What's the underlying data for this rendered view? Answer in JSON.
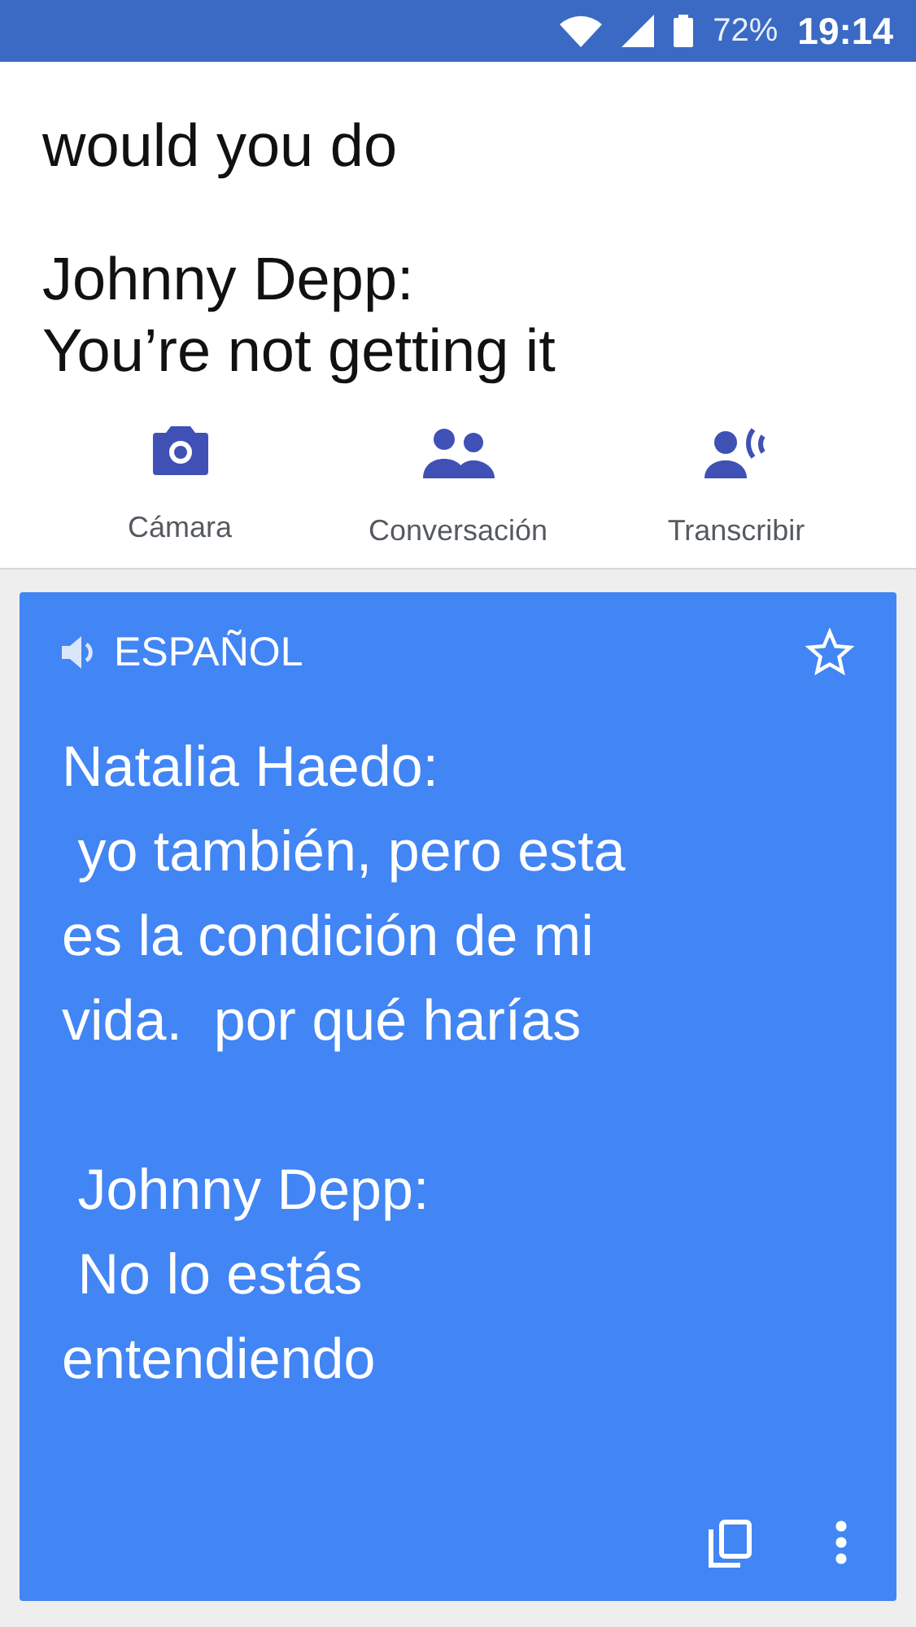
{
  "status_bar": {
    "battery": "72%",
    "time": "19:14"
  },
  "source": {
    "paragraphs": [
      [
        "would you do"
      ],
      [
        "Johnny Depp:",
        "You’re not getting it"
      ]
    ]
  },
  "actions": [
    {
      "kind": "camera",
      "label": "Cámara"
    },
    {
      "kind": "conversation",
      "label": "Conversación"
    },
    {
      "kind": "transcribe",
      "label": "Transcribir"
    }
  ],
  "translation": {
    "language": "ESPAÑOL",
    "starred": false,
    "paragraphs": [
      [
        "Natalia Haedo:",
        " yo también, pero esta",
        "es la condición de mi",
        "vida.  por qué harías"
      ],
      [
        " Johnny Depp:",
        " No lo estás",
        "entendiendo"
      ]
    ]
  }
}
